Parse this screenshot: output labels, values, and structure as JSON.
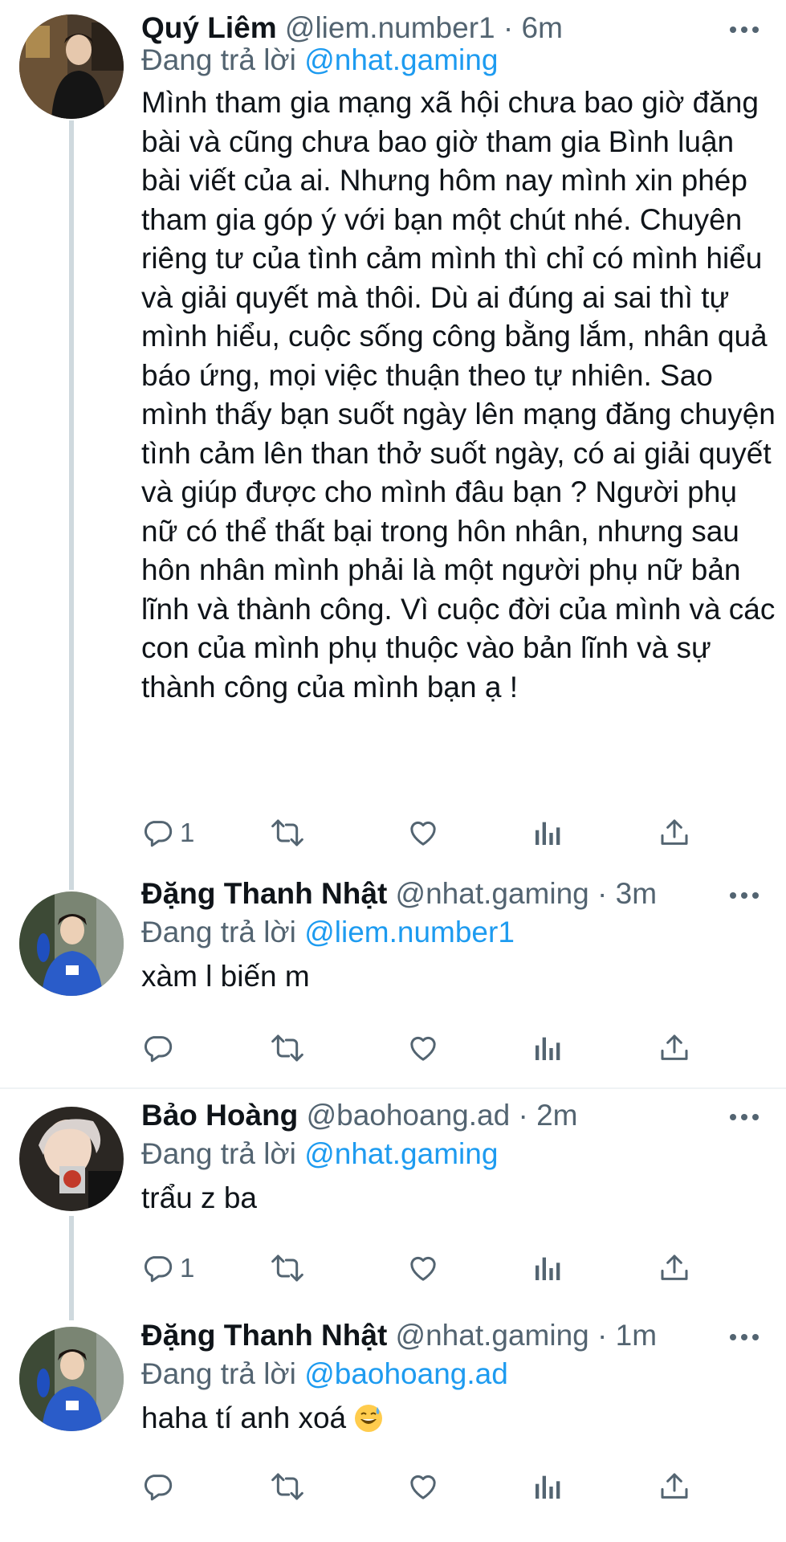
{
  "tweets": [
    {
      "name": "Quý Liêm",
      "handle": "@liem.number1",
      "dot": "·",
      "time": "6m",
      "replying_prefix": "Đang trả lời",
      "replying_to": "@nhat.gaming",
      "text": "Mình tham gia mạng xã hội chưa bao giờ đăng bài và cũng chưa bao giờ tham gia Bình luận bài viết của ai. Nhưng hôm nay mình xin phép tham gia góp ý với bạn một chút nhé. Chuyên riêng tư của tình cảm mình thì chỉ có mình hiểu và giải quyết mà thôi. Dù ai đúng ai sai thì tự mình hiểu, cuộc sống công bằng lắm, nhân quả báo ứng, mọi việc thuận theo tự nhiên. Sao mình thấy bạn suốt ngày lên mạng đăng chuyện tình cảm lên than thở suốt ngày, có ai giải quyết và giúp được cho mình đâu bạn ? Người phụ nữ có thể thất bại trong hôn nhân, nhưng sau hôn nhân mình phải là một người phụ nữ bản lĩnh và thành công. Vì cuộc đời của mình và các con của mình phụ thuộc vào bản lĩnh và sự thành công của mình bạn ạ !",
      "reply_count": "1"
    },
    {
      "name": "Đặng Thanh Nhật",
      "handle": "@nhat.gaming",
      "dot": "·",
      "time": "3m",
      "replying_prefix": "Đang trả lời",
      "replying_to": "@liem.number1",
      "text": "xàm l biến m",
      "reply_count": ""
    },
    {
      "name": "Bảo Hoàng",
      "handle": "@baohoang.ad",
      "dot": "·",
      "time": "2m",
      "replying_prefix": "Đang trả lời",
      "replying_to": "@nhat.gaming",
      "text": "trẩu z ba",
      "reply_count": "1"
    },
    {
      "name": "Đặng Thanh Nhật",
      "handle": "@nhat.gaming",
      "dot": "·",
      "time": "1m",
      "replying_prefix": "Đang trả lời",
      "replying_to": "@baohoang.ad",
      "text": "haha tí anh xoá",
      "reply_count": ""
    }
  ],
  "icons": {
    "reply": "reply-icon",
    "retweet": "retweet-icon",
    "like": "like-icon",
    "views": "views-icon",
    "share": "share-icon",
    "more": "more-icon"
  },
  "colors": {
    "link": "#1d9bf0",
    "secondary_text": "#536471",
    "primary_text": "#0f1419",
    "thread_line": "#cfd9de"
  }
}
